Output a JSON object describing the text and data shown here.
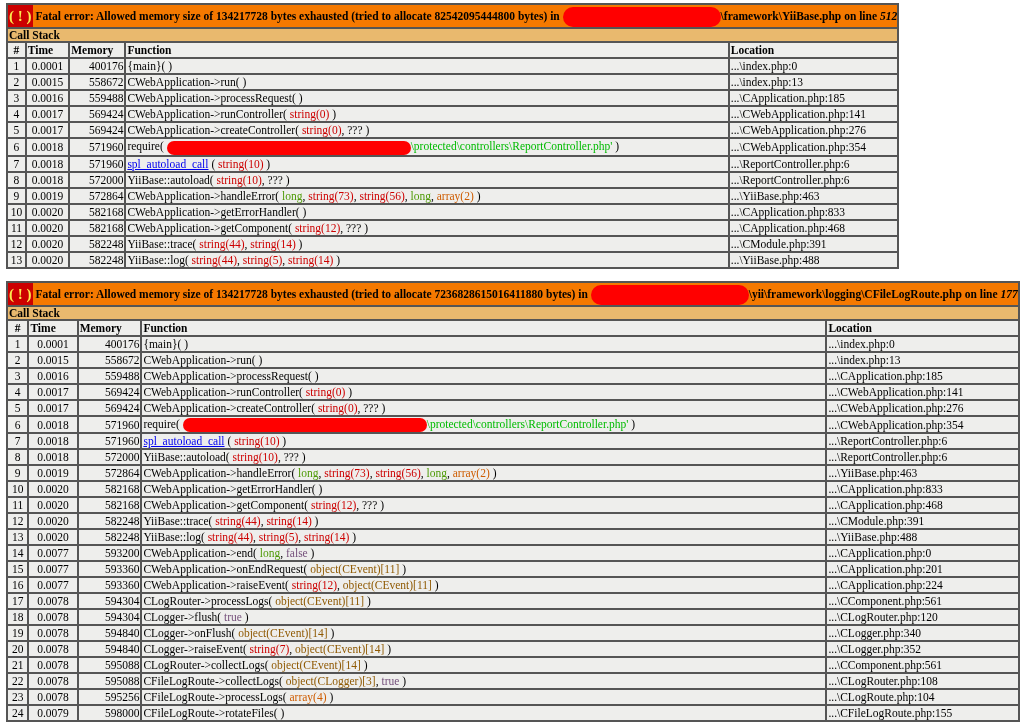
{
  "errors": [
    {
      "icon": "( ! )",
      "message": [
        {
          "kind": "plain",
          "text": "Fatal error: Allowed memory size of 134217728 bytes exhausted (tried to allocate 82542095444800 bytes) in "
        },
        {
          "kind": "redaction"
        },
        {
          "kind": "plain",
          "text": "\\framework\\YiiBase.php on line *512*"
        }
      ],
      "section": "Call Stack",
      "columns": [
        "#",
        "Time",
        "Memory",
        "Function",
        "Location"
      ],
      "rows": [
        {
          "n": "1",
          "time": "0.0001",
          "memory": "400176",
          "function": [
            {
              "kind": "plain",
              "text": "{main}( )"
            }
          ],
          "location": "...\\index.php:0"
        },
        {
          "n": "2",
          "time": "0.0015",
          "memory": "558672",
          "function": [
            {
              "kind": "plain",
              "text": "CWebApplication->run( )"
            }
          ],
          "location": "...\\index.php:13"
        },
        {
          "n": "3",
          "time": "0.0016",
          "memory": "559488",
          "function": [
            {
              "kind": "plain",
              "text": "CWebApplication->processRequest( )"
            }
          ],
          "location": "...\\CApplication.php:185"
        },
        {
          "n": "4",
          "time": "0.0017",
          "memory": "569424",
          "function": [
            {
              "kind": "plain",
              "text": "CWebApplication->runController( "
            },
            {
              "kind": "string",
              "text": "string(0)"
            },
            {
              "kind": "plain",
              "text": " )"
            }
          ],
          "location": "...\\CWebApplication.php:141"
        },
        {
          "n": "5",
          "time": "0.0017",
          "memory": "569424",
          "function": [
            {
              "kind": "plain",
              "text": "CWebApplication->createController( "
            },
            {
              "kind": "string",
              "text": "string(0)"
            },
            {
              "kind": "plain",
              "text": ", ??? )"
            }
          ],
          "location": "...\\CWebApplication.php:276"
        },
        {
          "n": "6",
          "time": "0.0018",
          "memory": "571960",
          "function": [
            {
              "kind": "plain",
              "text": "require( "
            },
            {
              "kind": "redaction"
            },
            {
              "kind": "path",
              "text": "\\protected\\controllers\\ReportController.php'"
            },
            {
              "kind": "plain",
              "text": " )"
            }
          ],
          "location": "...\\CWebApplication.php:354"
        },
        {
          "n": "7",
          "time": "0.0018",
          "memory": "571960",
          "function": [
            {
              "kind": "link",
              "text": "spl_autoload_call"
            },
            {
              "kind": "plain",
              "text": " ( "
            },
            {
              "kind": "string",
              "text": "string(10)"
            },
            {
              "kind": "plain",
              "text": " )"
            }
          ],
          "location": "...\\ReportController.php:6"
        },
        {
          "n": "8",
          "time": "0.0018",
          "memory": "572000",
          "function": [
            {
              "kind": "plain",
              "text": "YiiBase::autoload( "
            },
            {
              "kind": "string",
              "text": "string(10)"
            },
            {
              "kind": "plain",
              "text": ", ??? )"
            }
          ],
          "location": "...\\ReportController.php:6"
        },
        {
          "n": "9",
          "time": "0.0019",
          "memory": "572864",
          "function": [
            {
              "kind": "plain",
              "text": "CWebApplication->handleError( "
            },
            {
              "kind": "long",
              "text": "long"
            },
            {
              "kind": "plain",
              "text": ", "
            },
            {
              "kind": "string",
              "text": "string(73)"
            },
            {
              "kind": "plain",
              "text": ", "
            },
            {
              "kind": "string",
              "text": "string(56)"
            },
            {
              "kind": "plain",
              "text": ", "
            },
            {
              "kind": "long",
              "text": "long"
            },
            {
              "kind": "plain",
              "text": ", "
            },
            {
              "kind": "array",
              "text": "array(2)"
            },
            {
              "kind": "plain",
              "text": " )"
            }
          ],
          "location": "...\\YiiBase.php:463"
        },
        {
          "n": "10",
          "time": "0.0020",
          "memory": "582168",
          "function": [
            {
              "kind": "plain",
              "text": "CWebApplication->getErrorHandler( )"
            }
          ],
          "location": "...\\CApplication.php:833"
        },
        {
          "n": "11",
          "time": "0.0020",
          "memory": "582168",
          "function": [
            {
              "kind": "plain",
              "text": "CWebApplication->getComponent( "
            },
            {
              "kind": "string",
              "text": "string(12)"
            },
            {
              "kind": "plain",
              "text": ", ??? )"
            }
          ],
          "location": "...\\CApplication.php:468"
        },
        {
          "n": "12",
          "time": "0.0020",
          "memory": "582248",
          "function": [
            {
              "kind": "plain",
              "text": "YiiBase::trace( "
            },
            {
              "kind": "string",
              "text": "string(44)"
            },
            {
              "kind": "plain",
              "text": ", "
            },
            {
              "kind": "string",
              "text": "string(14)"
            },
            {
              "kind": "plain",
              "text": " )"
            }
          ],
          "location": "...\\CModule.php:391"
        },
        {
          "n": "13",
          "time": "0.0020",
          "memory": "582248",
          "function": [
            {
              "kind": "plain",
              "text": "YiiBase::log( "
            },
            {
              "kind": "string",
              "text": "string(44)"
            },
            {
              "kind": "plain",
              "text": ", "
            },
            {
              "kind": "string",
              "text": "string(5)"
            },
            {
              "kind": "plain",
              "text": ", "
            },
            {
              "kind": "string",
              "text": "string(14)"
            },
            {
              "kind": "plain",
              "text": " )"
            }
          ],
          "location": "...\\YiiBase.php:488"
        }
      ]
    },
    {
      "icon": "( ! )",
      "message": [
        {
          "kind": "plain",
          "text": "Fatal error: Allowed memory size of 134217728 bytes exhausted (tried to allocate 7236828615016411880 bytes) in "
        },
        {
          "kind": "redaction"
        },
        {
          "kind": "plain",
          "text": "\\yii\\framework\\logging\\CFileLogRoute.php on line *177*"
        }
      ],
      "section": "Call Stack",
      "columns": [
        "#",
        "Time",
        "Memory",
        "Function",
        "Location"
      ],
      "rows": [
        {
          "n": "1",
          "time": "0.0001",
          "memory": "400176",
          "function": [
            {
              "kind": "plain",
              "text": "{main}( )"
            }
          ],
          "location": "...\\index.php:0"
        },
        {
          "n": "2",
          "time": "0.0015",
          "memory": "558672",
          "function": [
            {
              "kind": "plain",
              "text": "CWebApplication->run( )"
            }
          ],
          "location": "...\\index.php:13"
        },
        {
          "n": "3",
          "time": "0.0016",
          "memory": "559488",
          "function": [
            {
              "kind": "plain",
              "text": "CWebApplication->processRequest( )"
            }
          ],
          "location": "...\\CApplication.php:185"
        },
        {
          "n": "4",
          "time": "0.0017",
          "memory": "569424",
          "function": [
            {
              "kind": "plain",
              "text": "CWebApplication->runController( "
            },
            {
              "kind": "string",
              "text": "string(0)"
            },
            {
              "kind": "plain",
              "text": " )"
            }
          ],
          "location": "...\\CWebApplication.php:141"
        },
        {
          "n": "5",
          "time": "0.0017",
          "memory": "569424",
          "function": [
            {
              "kind": "plain",
              "text": "CWebApplication->createController( "
            },
            {
              "kind": "string",
              "text": "string(0)"
            },
            {
              "kind": "plain",
              "text": ", ??? )"
            }
          ],
          "location": "...\\CWebApplication.php:276"
        },
        {
          "n": "6",
          "time": "0.0018",
          "memory": "571960",
          "function": [
            {
              "kind": "plain",
              "text": "require( "
            },
            {
              "kind": "redaction"
            },
            {
              "kind": "path",
              "text": "\\protected\\controllers\\ReportController.php'"
            },
            {
              "kind": "plain",
              "text": " )"
            }
          ],
          "location": "...\\CWebApplication.php:354"
        },
        {
          "n": "7",
          "time": "0.0018",
          "memory": "571960",
          "function": [
            {
              "kind": "link",
              "text": "spl_autoload_call"
            },
            {
              "kind": "plain",
              "text": " ( "
            },
            {
              "kind": "string",
              "text": "string(10)"
            },
            {
              "kind": "plain",
              "text": " )"
            }
          ],
          "location": "...\\ReportController.php:6"
        },
        {
          "n": "8",
          "time": "0.0018",
          "memory": "572000",
          "function": [
            {
              "kind": "plain",
              "text": "YiiBase::autoload( "
            },
            {
              "kind": "string",
              "text": "string(10)"
            },
            {
              "kind": "plain",
              "text": ", ??? )"
            }
          ],
          "location": "...\\ReportController.php:6"
        },
        {
          "n": "9",
          "time": "0.0019",
          "memory": "572864",
          "function": [
            {
              "kind": "plain",
              "text": "CWebApplication->handleError( "
            },
            {
              "kind": "long",
              "text": "long"
            },
            {
              "kind": "plain",
              "text": ", "
            },
            {
              "kind": "string",
              "text": "string(73)"
            },
            {
              "kind": "plain",
              "text": ", "
            },
            {
              "kind": "string",
              "text": "string(56)"
            },
            {
              "kind": "plain",
              "text": ", "
            },
            {
              "kind": "long",
              "text": "long"
            },
            {
              "kind": "plain",
              "text": ", "
            },
            {
              "kind": "array",
              "text": "array(2)"
            },
            {
              "kind": "plain",
              "text": " )"
            }
          ],
          "location": "...\\YiiBase.php:463"
        },
        {
          "n": "10",
          "time": "0.0020",
          "memory": "582168",
          "function": [
            {
              "kind": "plain",
              "text": "CWebApplication->getErrorHandler( )"
            }
          ],
          "location": "...\\CApplication.php:833"
        },
        {
          "n": "11",
          "time": "0.0020",
          "memory": "582168",
          "function": [
            {
              "kind": "plain",
              "text": "CWebApplication->getComponent( "
            },
            {
              "kind": "string",
              "text": "string(12)"
            },
            {
              "kind": "plain",
              "text": ", ??? )"
            }
          ],
          "location": "...\\CApplication.php:468"
        },
        {
          "n": "12",
          "time": "0.0020",
          "memory": "582248",
          "function": [
            {
              "kind": "plain",
              "text": "YiiBase::trace( "
            },
            {
              "kind": "string",
              "text": "string(44)"
            },
            {
              "kind": "plain",
              "text": ", "
            },
            {
              "kind": "string",
              "text": "string(14)"
            },
            {
              "kind": "plain",
              "text": " )"
            }
          ],
          "location": "...\\CModule.php:391"
        },
        {
          "n": "13",
          "time": "0.0020",
          "memory": "582248",
          "function": [
            {
              "kind": "plain",
              "text": "YiiBase::log( "
            },
            {
              "kind": "string",
              "text": "string(44)"
            },
            {
              "kind": "plain",
              "text": ", "
            },
            {
              "kind": "string",
              "text": "string(5)"
            },
            {
              "kind": "plain",
              "text": ", "
            },
            {
              "kind": "string",
              "text": "string(14)"
            },
            {
              "kind": "plain",
              "text": " )"
            }
          ],
          "location": "...\\YiiBase.php:488"
        },
        {
          "n": "14",
          "time": "0.0077",
          "memory": "593200",
          "function": [
            {
              "kind": "plain",
              "text": "CWebApplication->end( "
            },
            {
              "kind": "long",
              "text": "long"
            },
            {
              "kind": "plain",
              "text": ", "
            },
            {
              "kind": "bool",
              "text": "false"
            },
            {
              "kind": "plain",
              "text": " )"
            }
          ],
          "location": "...\\CApplication.php:0"
        },
        {
          "n": "15",
          "time": "0.0077",
          "memory": "593360",
          "function": [
            {
              "kind": "plain",
              "text": "CWebApplication->onEndRequest( "
            },
            {
              "kind": "object",
              "text": "object(CEvent)[11]"
            },
            {
              "kind": "plain",
              "text": " )"
            }
          ],
          "location": "...\\CApplication.php:201"
        },
        {
          "n": "16",
          "time": "0.0077",
          "memory": "593360",
          "function": [
            {
              "kind": "plain",
              "text": "CWebApplication->raiseEvent( "
            },
            {
              "kind": "string",
              "text": "string(12)"
            },
            {
              "kind": "plain",
              "text": ", "
            },
            {
              "kind": "object",
              "text": "object(CEvent)[11]"
            },
            {
              "kind": "plain",
              "text": " )"
            }
          ],
          "location": "...\\CApplication.php:224"
        },
        {
          "n": "17",
          "time": "0.0078",
          "memory": "594304",
          "function": [
            {
              "kind": "plain",
              "text": "CLogRouter->processLogs( "
            },
            {
              "kind": "object",
              "text": "object(CEvent)[11]"
            },
            {
              "kind": "plain",
              "text": " )"
            }
          ],
          "location": "...\\CComponent.php:561"
        },
        {
          "n": "18",
          "time": "0.0078",
          "memory": "594304",
          "function": [
            {
              "kind": "plain",
              "text": "CLogger->flush( "
            },
            {
              "kind": "bool",
              "text": "true"
            },
            {
              "kind": "plain",
              "text": " )"
            }
          ],
          "location": "...\\CLogRouter.php:120"
        },
        {
          "n": "19",
          "time": "0.0078",
          "memory": "594840",
          "function": [
            {
              "kind": "plain",
              "text": "CLogger->onFlush( "
            },
            {
              "kind": "object",
              "text": "object(CEvent)[14]"
            },
            {
              "kind": "plain",
              "text": " )"
            }
          ],
          "location": "...\\CLogger.php:340"
        },
        {
          "n": "20",
          "time": "0.0078",
          "memory": "594840",
          "function": [
            {
              "kind": "plain",
              "text": "CLogger->raiseEvent( "
            },
            {
              "kind": "string",
              "text": "string(7)"
            },
            {
              "kind": "plain",
              "text": ", "
            },
            {
              "kind": "object",
              "text": "object(CEvent)[14]"
            },
            {
              "kind": "plain",
              "text": " )"
            }
          ],
          "location": "...\\CLogger.php:352"
        },
        {
          "n": "21",
          "time": "0.0078",
          "memory": "595088",
          "function": [
            {
              "kind": "plain",
              "text": "CLogRouter->collectLogs( "
            },
            {
              "kind": "object",
              "text": "object(CEvent)[14]"
            },
            {
              "kind": "plain",
              "text": " )"
            }
          ],
          "location": "...\\CComponent.php:561"
        },
        {
          "n": "22",
          "time": "0.0078",
          "memory": "595088",
          "function": [
            {
              "kind": "plain",
              "text": "CFileLogRoute->collectLogs( "
            },
            {
              "kind": "object",
              "text": "object(CLogger)[3]"
            },
            {
              "kind": "plain",
              "text": ", "
            },
            {
              "kind": "bool",
              "text": "true"
            },
            {
              "kind": "plain",
              "text": " )"
            }
          ],
          "location": "...\\CLogRouter.php:108"
        },
        {
          "n": "23",
          "time": "0.0078",
          "memory": "595256",
          "function": [
            {
              "kind": "plain",
              "text": "CFileLogRoute->processLogs( "
            },
            {
              "kind": "array",
              "text": "array(4)"
            },
            {
              "kind": "plain",
              "text": " )"
            }
          ],
          "location": "...\\CLogRoute.php:104"
        },
        {
          "n": "24",
          "time": "0.0079",
          "memory": "598000",
          "function": [
            {
              "kind": "plain",
              "text": "CFileLogRoute->rotateFiles( )"
            }
          ],
          "location": "...\\CFileLogRoute.php:155"
        }
      ]
    }
  ]
}
